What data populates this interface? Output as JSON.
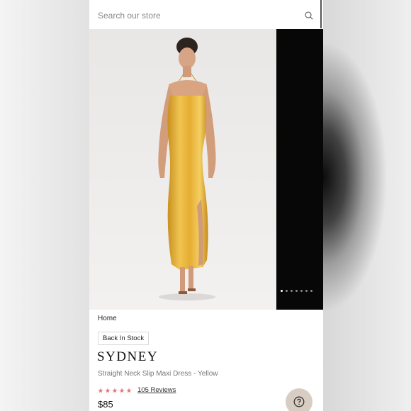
{
  "search": {
    "placeholder": "Search our store",
    "icon": "search-icon"
  },
  "gallery": {
    "image_alt": "Model wearing yellow satin slip maxi dress",
    "dot_count": 7,
    "active_dot": 0
  },
  "breadcrumb": {
    "home_label": "Home"
  },
  "product": {
    "badge": "Back In Stock",
    "title": "SYDNEY",
    "subtitle": "Straight Neck Slip Maxi Dress - Yellow",
    "rating": 5,
    "reviews_label": "105 Reviews",
    "price": "$85"
  },
  "colors": {
    "star": "#e07f7f",
    "help_button": "#d8cdc3",
    "dress": "#e9b43a"
  },
  "help": {
    "icon": "question-mark-icon"
  }
}
